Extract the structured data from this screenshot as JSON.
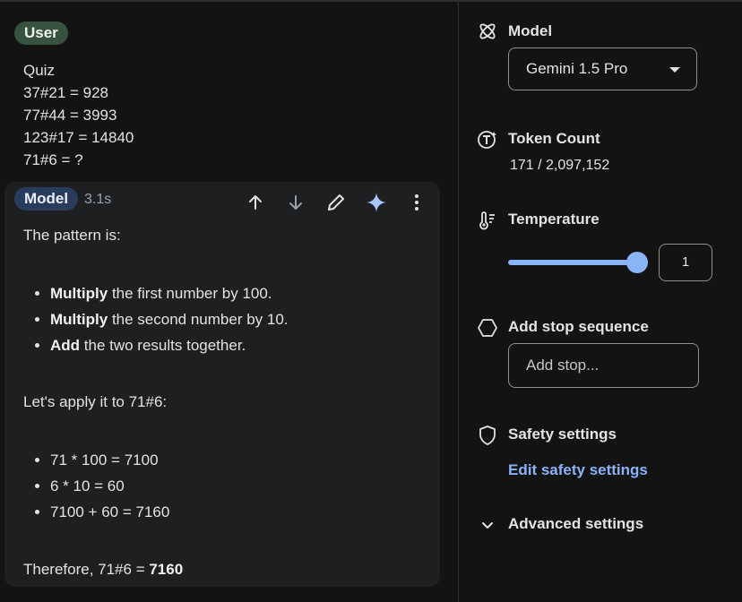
{
  "user_message": {
    "role_label": "User",
    "lines": [
      "Quiz",
      "37#21 = 928",
      "77#44 = 3993",
      "123#17 = 14840",
      "71#6 = ?"
    ]
  },
  "model_message": {
    "role_label": "Model",
    "elapsed": "3.1s",
    "toolbar_icons": [
      "arrow-up-icon",
      "arrow-down-icon",
      "pencil-icon",
      "sparkle-icon",
      "more-vert-icon"
    ],
    "intro": "The pattern is:",
    "steps": [
      {
        "bold": "Multiply",
        "rest": " the first number by 100."
      },
      {
        "bold": "Multiply",
        "rest": " the second number by 10."
      },
      {
        "bold": "Add",
        "rest": " the two results together."
      }
    ],
    "apply_line": "Let's apply it to 71#6:",
    "calc": [
      "71 * 100 = 7100",
      "6 * 10 = 60",
      "7100 + 60 = 7160"
    ],
    "conclusion_prefix": "Therefore, 71#6 = ",
    "conclusion_answer": "7160"
  },
  "settings": {
    "model": {
      "title": "Model",
      "selected": "Gemini 1.5 Pro"
    },
    "token_count": {
      "title": "Token Count",
      "value": "171 / 2,097,152"
    },
    "temperature": {
      "title": "Temperature",
      "value": "1",
      "level_fraction": 1.0
    },
    "stop_sequence": {
      "title": "Add stop sequence",
      "placeholder": "Add stop..."
    },
    "safety": {
      "title": "Safety settings",
      "link": "Edit safety settings"
    },
    "advanced": {
      "title": "Advanced settings"
    }
  },
  "colors": {
    "background": "#131314",
    "card": "#1e1f20",
    "user_badge": "#37523f",
    "model_badge": "#2a3c5c",
    "accent": "#8ab4f8",
    "sparkle": "#a8c7fa"
  }
}
